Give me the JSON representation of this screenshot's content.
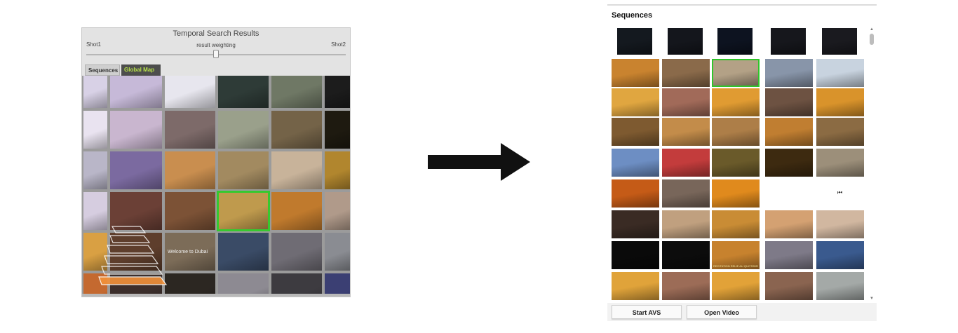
{
  "left": {
    "title": "Temporal Search Results",
    "shot1_label": "Shot1",
    "shot2_label": "Shot2",
    "slider_label": "result weighting",
    "slider_value": 0.5,
    "tabs": [
      "Sequences",
      "Global Map"
    ],
    "active_tab": "Global Map",
    "thumbnail_text": "Welcome to Dubai",
    "grid_rows": [
      [
        "#d8d1e6",
        "#c6b9d8",
        "#e7e6ee",
        "#2e3b37",
        "#6f7865",
        "#1c1c1c"
      ],
      [
        "#e9e3f0",
        "#c9b6cf",
        "#7d6a69",
        "#9aa08b",
        "#746348",
        "#1e1a10"
      ],
      [
        "#b9b6c8",
        "#7b6aa0",
        "#c98e4f",
        "#a28a60",
        "#c8b39a",
        "#b1862e"
      ],
      [
        "#d6cde0",
        "#6b4036",
        "#7c5236",
        "#bf9a4d",
        "#c07a2d",
        "#b09a8a"
      ],
      [
        "#d9a043",
        "#5e3e2c",
        "#7c6c58",
        "#3a4b66",
        "#6f6c74",
        "#8a8c92"
      ],
      [
        "#c46930",
        "#3b2e2b",
        "#2c2722",
        "#8d8a92",
        "#3d3b40",
        "#3b3f73"
      ]
    ],
    "selected_cell": [
      3,
      3
    ]
  },
  "right": {
    "title": "Sequences",
    "buttons": {
      "start_avs": "Start AVS",
      "open_video": "Open Video"
    },
    "grid_rows": [
      [
        "#14191f",
        "#14161c",
        "#0d1320",
        "#16171c",
        "#1a1a1f"
      ],
      [
        "#c9832f",
        "#8a6a4a",
        "#b3a186",
        "#8895a9",
        "#c8d3df"
      ],
      [
        "#e0a640",
        "#a16a59",
        "#e09b32",
        "#6d5242",
        "#d9932b"
      ],
      [
        "#7e5a30",
        "#c38c4a",
        "#ad7e48",
        "#c07e31",
        "#8b6b43"
      ],
      [
        "#6d8ec3",
        "#c33c3c",
        "#6a5a2a",
        "#3d2a10",
        "#9c8f7a"
      ],
      [
        "#c55b17",
        "#78665a",
        "#e08a1d",
        "#ffffff",
        "#ffffff"
      ],
      [
        "#3a2b24",
        "#c0a07f",
        "#c98c35",
        "#d4a172",
        "#d1b7a0"
      ],
      [
        "#0a0a0a",
        "#0c0c0c",
        "#c7822e",
        "#7e7a88",
        "#3a5a8e"
      ],
      [
        "#e0a33a",
        "#9c6c57",
        "#e2a238",
        "#8a6450",
        "#a4a9a7"
      ]
    ],
    "selected_cell": [
      1,
      2
    ],
    "caption_thumbnail_text": "RECITATION RELIE AU QUOTIDIENNE",
    "play_icon_cell": [
      5,
      4
    ]
  },
  "icons": {
    "arrow": "arrow-right-icon",
    "scroll_up": "scroll-up-icon",
    "scroll_down": "scroll-down-icon",
    "play": "skip-back-icon"
  }
}
